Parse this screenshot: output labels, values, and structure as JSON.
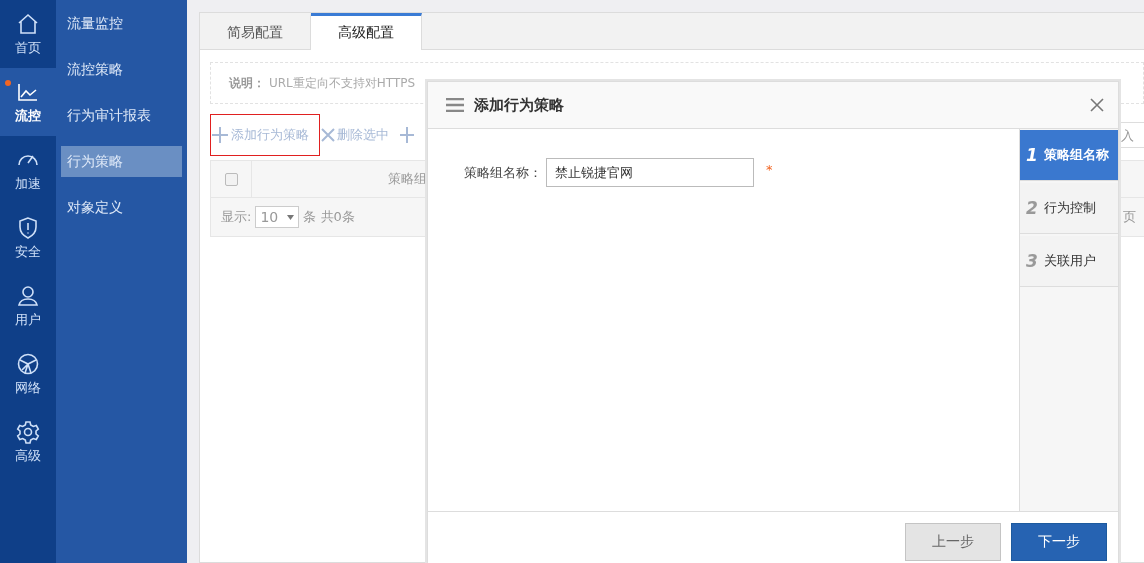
{
  "rail": [
    {
      "label": "首页",
      "kind": "home",
      "selected": false,
      "dot": false
    },
    {
      "label": "流控",
      "kind": "chart",
      "selected": true,
      "dot": true
    },
    {
      "label": "加速",
      "kind": "gauge",
      "selected": false,
      "dot": false
    },
    {
      "label": "安全",
      "kind": "shield",
      "selected": false,
      "dot": false
    },
    {
      "label": "用户",
      "kind": "user",
      "selected": false,
      "dot": false
    },
    {
      "label": "网络",
      "kind": "globe",
      "selected": false,
      "dot": false
    },
    {
      "label": "高级",
      "kind": "gear",
      "selected": false,
      "dot": false
    }
  ],
  "submenu": [
    {
      "label": "流量监控",
      "selected": false
    },
    {
      "label": "流控策略",
      "selected": false
    },
    {
      "label": "行为审计报表",
      "selected": false
    },
    {
      "label": "行为策略",
      "selected": true
    },
    {
      "label": "对象定义",
      "selected": false
    }
  ],
  "tabs": [
    {
      "label": "简易配置",
      "selected": false
    },
    {
      "label": "高级配置",
      "selected": true
    }
  ],
  "note": {
    "label": "说明：",
    "text": "URL重定向不支持对HTTPS"
  },
  "toolbar": {
    "add": {
      "label": "添加行为策略",
      "highlighted": true
    },
    "delete": {
      "label": "删除选中"
    }
  },
  "search": {
    "placeholder": "入"
  },
  "table": {
    "select_all": {
      "checked": false
    },
    "column_1": "策略组",
    "footer": {
      "show_label": "显示:",
      "page_size": "10",
      "count": "条 共0条",
      "pager": "页"
    }
  },
  "modal": {
    "title": "添加行为策略",
    "field": {
      "label": "策略组名称：",
      "value": "禁止锐捷官网",
      "required": true,
      "required_mark": "*"
    },
    "steps": [
      {
        "number": "1",
        "label": "策略组名称",
        "selected": true
      },
      {
        "number": "2",
        "label": "行为控制",
        "selected": false
      },
      {
        "number": "3",
        "label": "关联用户",
        "selected": false
      }
    ],
    "buttons": {
      "prev": "上一步",
      "next": "下一步"
    }
  }
}
